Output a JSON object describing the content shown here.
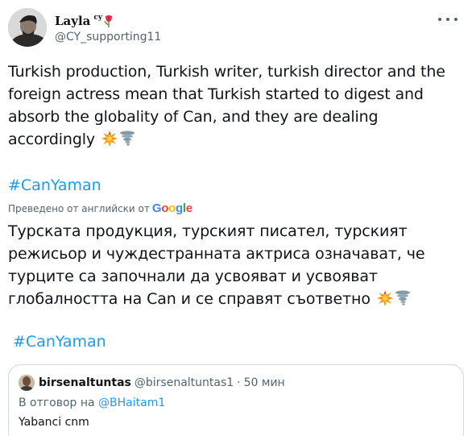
{
  "author": {
    "display_name": "Layla",
    "display_suffix": "cy",
    "handle": "@CY_supporting11"
  },
  "tweet": {
    "text": "Turkish production, Turkish writer, turkish director and the foreign actress mean that Turkish started to digest and absorb the globality of Can, and  they are dealing accordingly",
    "hashtag": "#CanYaman",
    "emojis": [
      "collision-emoji",
      "tornado-emoji"
    ]
  },
  "translation": {
    "label": "Преведено от английски от",
    "provider": "Google",
    "text": "Турската продукция, турският писател, турският режисьор и чуждестранната актриса означават, че турците са започнали да усвояват и усвояват глобалността на Can и се справят съответно",
    "hashtag": "#CanYaman"
  },
  "quote": {
    "name": "birsenaltuntas",
    "handle": "@birsenaltuntas1",
    "separator": "·",
    "time": "50 мин",
    "reply_prefix": "В отговор на",
    "reply_handle": "@BHaitam1",
    "text": "Yabanci cnm"
  },
  "colors": {
    "link": "#1d9bf0",
    "secondary_text": "#536471",
    "border": "#cfd9de"
  }
}
